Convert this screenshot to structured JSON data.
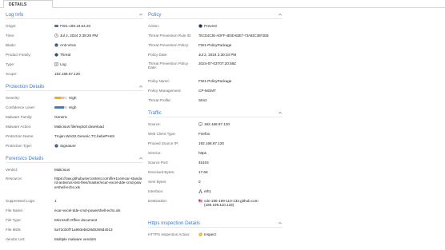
{
  "tabs": {
    "details": "DETAILS"
  },
  "log_info": {
    "title": "Log Info",
    "rows": [
      {
        "label": "Origin:",
        "value": "FW1-199.19.64.20"
      },
      {
        "label": "Time:",
        "value": "Jul 2, 2024 2:39:25 PM"
      },
      {
        "label": "Blade:",
        "value": "Anti-Virus"
      },
      {
        "label": "Product Family:",
        "value": "Threat"
      },
      {
        "label": "Type:",
        "value": "Log"
      },
      {
        "label": "Scope:",
        "value": "192.168.67.120"
      }
    ]
  },
  "protection_details": {
    "title": "Protection Details",
    "rows": [
      {
        "label": "Severity:",
        "value": "High"
      },
      {
        "label": "Confidence Level:",
        "value": "High"
      },
      {
        "label": "Malware Family:",
        "value": "Generic"
      },
      {
        "label": "Malware Action:",
        "value": "Malicious file/exploit download"
      },
      {
        "label": "Protection Name:",
        "value": "Trojan.Win32.Generic.TC.bebePHsS"
      },
      {
        "label": "Protection Type:",
        "value": "Signature"
      }
    ]
  },
  "forensics_details": {
    "title": "Forensics Details",
    "rows": [
      {
        "label": "Verdict:",
        "value": "Malicious"
      },
      {
        "label": "Resource:",
        "value": "https://raw.githubusercontent.com/fire1ce/ecar-standard-antivirus-test-files/master/ecar-excel-dde-cmd-powershell-echo.xls"
      },
      {
        "label": "Suppressed Logs:",
        "value": "1"
      },
      {
        "label": "File Name:",
        "value": "ecar-excel-dde-cmd-powershell-echo.xls"
      },
      {
        "label": "File Type:",
        "value": "Microsoft Office document"
      },
      {
        "label": "File MD5:",
        "value": "5a72cb0f71a993eb628d0269d4013"
      },
      {
        "label": "Vendor List:",
        "value": "Multiple malware vendors"
      }
    ]
  },
  "policy": {
    "title": "Policy",
    "rows": [
      {
        "label": "Action:",
        "value": "Prevent"
      },
      {
        "label": "Threat Prevention Rule ID:",
        "value": "7ECD4C3E-ADFF-4E0D-B3E7-73A83C3EF2EB"
      },
      {
        "label": "Threat Prevention Policy:",
        "value": "FW1-PolicyPackage"
      },
      {
        "label": "Policy Date:",
        "value": "Jul 2, 2024 2:30:34 PM"
      },
      {
        "label": "Threat Prevention Policy Date:",
        "value": "2024-07-02T07:20:59Z"
      },
      {
        "label": "Policy Name:",
        "value": "FW1-PolicyPackage"
      },
      {
        "label": "Policy Management:",
        "value": "CP-MGMT"
      },
      {
        "label": "Threat Profile:",
        "value": "Strict"
      }
    ]
  },
  "traffic": {
    "title": "Traffic",
    "rows": [
      {
        "label": "Source:",
        "value": "192.168.67.120"
      },
      {
        "label": "Web Client Type:",
        "value": "Firefox"
      },
      {
        "label": "Proxied Source IP:",
        "value": "192.168.67.120"
      },
      {
        "label": "Service:",
        "value": "https"
      },
      {
        "label": "Source Port:",
        "value": "45104"
      },
      {
        "label": "Received Bytes:",
        "value": "17.6K"
      },
      {
        "label": "Sent Bytes:",
        "value": "0"
      },
      {
        "label": "Interface:",
        "value": "eth1"
      },
      {
        "label": "Destination:",
        "value": "cdn-185-199-110-133.github.com (185.199.110.133)"
      }
    ]
  },
  "https_inspection": {
    "title": "Https Inspection Details",
    "rows": [
      {
        "label": "HTTPS Inspection Action:",
        "value": "Inspect"
      }
    ]
  },
  "colors": {
    "accent": "#3a7bd5",
    "severity": "#f5a623",
    "prevent": "#1f3b63",
    "inspect": "#f0a500"
  },
  "icons": [
    "gateway-icon",
    "clock-icon",
    "antivirus-icon",
    "threat-icon",
    "log-icon",
    "signature-icon",
    "shield-icon",
    "computer-icon",
    "network-icon",
    "flag-icon",
    "inspect-icon",
    "chevron-up-icon"
  ]
}
